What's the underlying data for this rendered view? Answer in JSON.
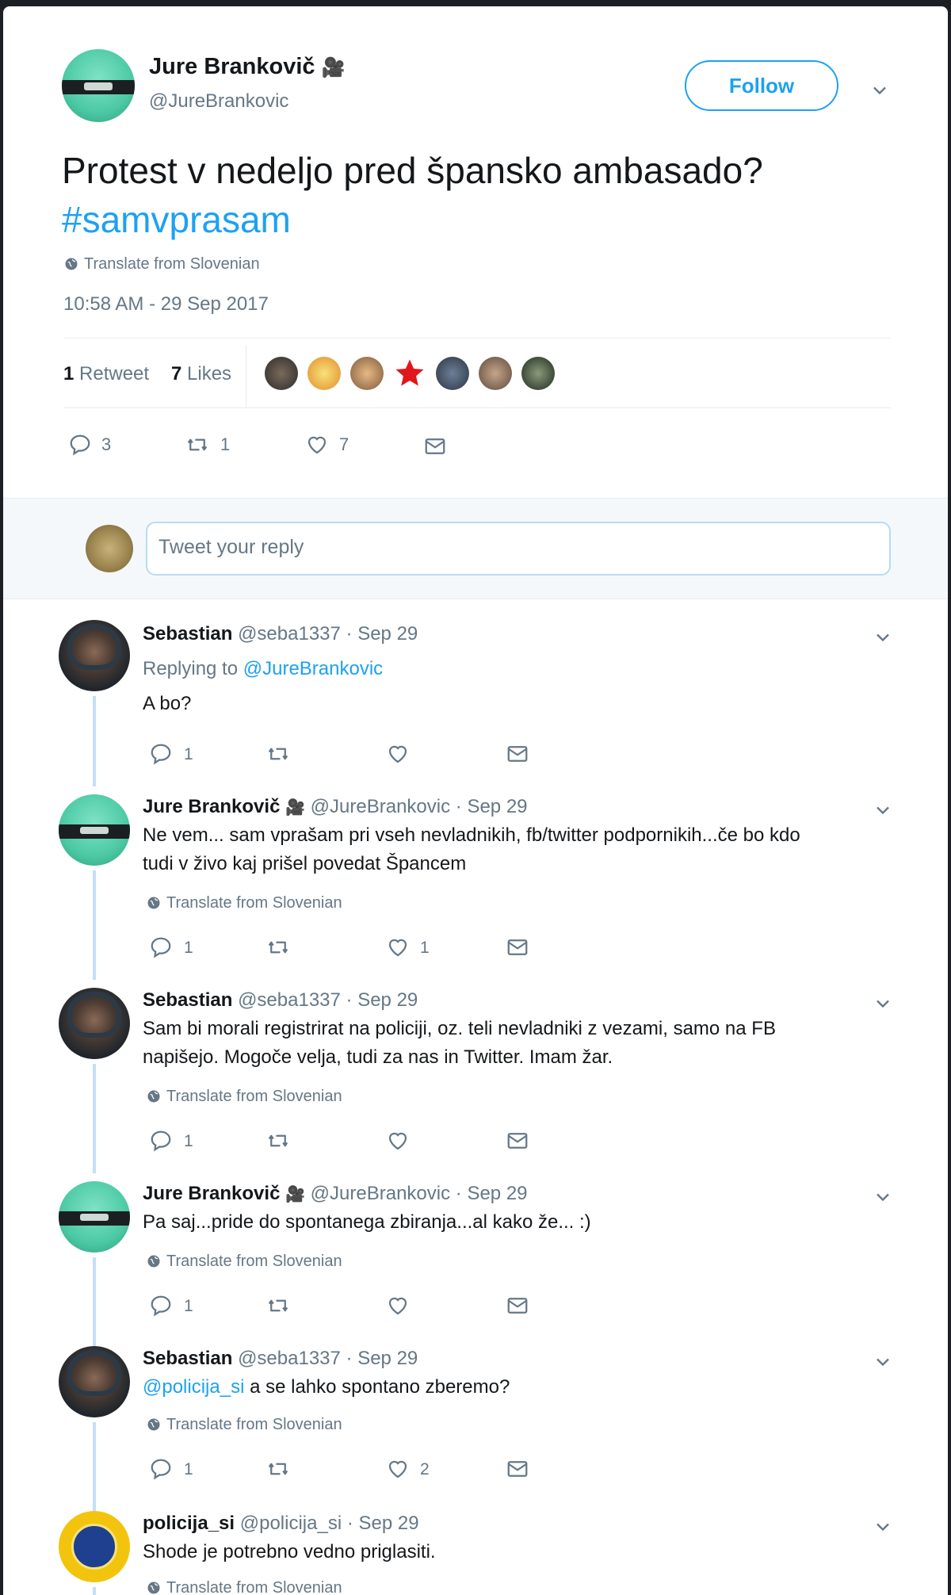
{
  "main_tweet": {
    "author_name": "Jure Brankovič",
    "author_badge": "🎥",
    "author_handle": "@JureBrankovic",
    "follow_label": "Follow",
    "text": "Protest v nedeljo pred špansko ambasado?",
    "hashtag": "#samvprasam",
    "translate_label": "Translate from Slovenian",
    "timestamp": "10:58 AM - 29 Sep 2017",
    "retweets_count": "1",
    "retweets_label": "Retweet",
    "likes_count": "7",
    "likes_label": "Likes",
    "actions": {
      "reply": "3",
      "retweet": "1",
      "like": "7"
    }
  },
  "reply_box": {
    "placeholder": "Tweet your reply"
  },
  "replies": [
    {
      "name": "Sebastian",
      "handle": "@seba1337",
      "date": "· Sep 29",
      "replying_prefix": "Replying to",
      "replying_to": "@JureBrankovic",
      "text": "A bo?",
      "reply_count": "1",
      "like_count": ""
    },
    {
      "name": "Jure Brankovič",
      "badge": "🎥",
      "handle": "@JureBrankovic",
      "date": "· Sep 29",
      "text_line1": "Ne vem... sam vprašam pri vseh nevladnikih, fb/twitter podpornikih...če bo kdo",
      "text_line2": "tudi v živo kaj prišel povedat Špancem",
      "translate_label": "Translate from Slovenian",
      "reply_count": "1",
      "like_count": "1"
    },
    {
      "name": "Sebastian",
      "handle": "@seba1337",
      "date": "· Sep 29",
      "text_line1": "Sam bi morali registrirat na policiji, oz. teli nevladniki z vezami, samo na FB",
      "text_line2": "napišejo. Mogoče velja, tudi za nas in Twitter. Imam žar.",
      "translate_label": "Translate from Slovenian",
      "reply_count": "1",
      "like_count": ""
    },
    {
      "name": "Jure Brankovič",
      "badge": "🎥",
      "handle": "@JureBrankovic",
      "date": "· Sep 29",
      "text": "Pa saj...pride do spontanega zbiranja...al kako že... :)",
      "translate_label": "Translate from Slovenian",
      "reply_count": "1",
      "like_count": ""
    },
    {
      "name": "Sebastian",
      "handle": "@seba1337",
      "date": "· Sep 29",
      "mention": "@policija_si",
      "text": "a se lahko spontano zberemo?",
      "translate_label": "Translate from Slovenian",
      "reply_count": "1",
      "like_count": "2"
    },
    {
      "name": "policija_si",
      "handle": "@policija_si",
      "date": "· Sep 29",
      "text": "Shode je potrebno vedno priglasiti.",
      "translate_label": "Translate from Slovenian"
    }
  ],
  "colors": {
    "accent": "#1da1f2",
    "muted": "#657786",
    "thread": "#c4dff5",
    "like_heart": "#e0245e"
  }
}
